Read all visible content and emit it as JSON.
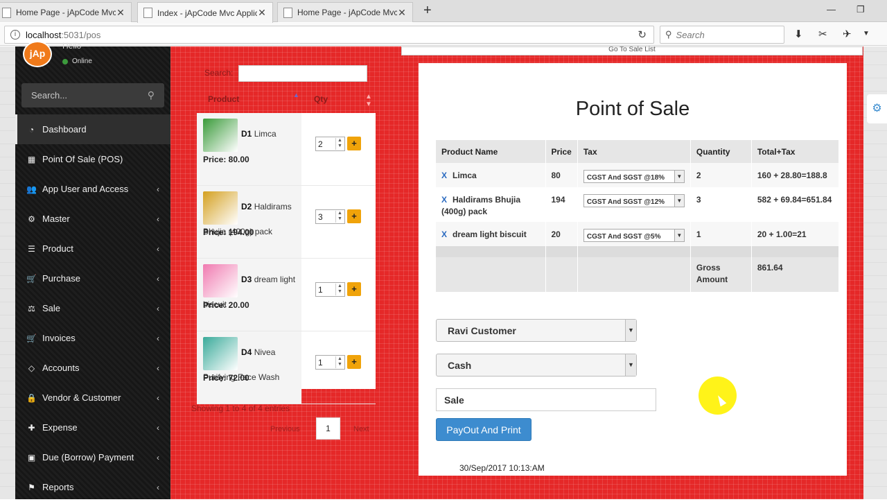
{
  "browser": {
    "tabs": [
      {
        "label": "Home Page - jApCode Mvc"
      },
      {
        "label": "Index - jApCode Mvc Applic"
      },
      {
        "label": "Home Page - jApCode Mvc"
      }
    ],
    "url_host": "localhost",
    "url_path": ":5031/pos",
    "search_placeholder": "Search"
  },
  "sidebar": {
    "avatar_text": "jAp",
    "greeting": "Hello",
    "status": "Online",
    "search_placeholder": "Search...",
    "items": [
      {
        "label": "Dashboard",
        "icon": "dashboard-icon",
        "glyph": "◔",
        "arrow": ""
      },
      {
        "label": "Point Of Sale (POS)",
        "icon": "calculator-icon",
        "glyph": "▦",
        "arrow": ""
      },
      {
        "label": "App User and Access",
        "icon": "users-icon",
        "glyph": "👥",
        "arrow": "‹"
      },
      {
        "label": "Master",
        "icon": "gear-icon",
        "glyph": "⚙",
        "arrow": "‹"
      },
      {
        "label": "Product",
        "icon": "list-icon",
        "glyph": "☰",
        "arrow": "‹"
      },
      {
        "label": "Purchase",
        "icon": "cart-icon",
        "glyph": "🛒",
        "arrow": "‹"
      },
      {
        "label": "Sale",
        "icon": "scale-icon",
        "glyph": "⚖",
        "arrow": "‹"
      },
      {
        "label": "Invoices",
        "icon": "cart-icon",
        "glyph": "🛒",
        "arrow": "‹"
      },
      {
        "label": "Accounts",
        "icon": "diamond-icon",
        "glyph": "◇",
        "arrow": "‹"
      },
      {
        "label": "Vendor & Customer",
        "icon": "lock-icon",
        "glyph": "🔒",
        "arrow": "‹"
      },
      {
        "label": "Expense",
        "icon": "plus-icon",
        "glyph": "✚",
        "arrow": "‹"
      },
      {
        "label": "Due (Borrow) Payment",
        "icon": "money-icon",
        "glyph": "▣",
        "arrow": "‹"
      },
      {
        "label": "Reports",
        "icon": "flag-icon",
        "glyph": "⚑",
        "arrow": "‹"
      }
    ]
  },
  "top": {
    "sale_list_link": "Go To Sale List"
  },
  "products": {
    "search_label": "Search:",
    "col_product": "Product",
    "col_qty": "Qty",
    "items": [
      {
        "code": "D1",
        "name": "Limca",
        "price": "Price: 80.00",
        "qty": "2",
        "color": "#3a9a3a"
      },
      {
        "code": "D2",
        "name": "Haldirams Bhujia (400g) pack",
        "price": "Price: 194.00",
        "qty": "3",
        "color": "#d4a020"
      },
      {
        "code": "D3",
        "name": "dream light biscuit",
        "price": "Price: 20.00",
        "qty": "1",
        "color": "#f07ab0"
      },
      {
        "code": "D4",
        "name": "Nivea Purifying Face Wash",
        "price": "Price: 72.00",
        "qty": "1",
        "color": "#3aaa9a"
      }
    ],
    "info": "Showing 1 to 4 of 4 entries",
    "prev": "Previous",
    "page": "1",
    "next": "Next"
  },
  "pos": {
    "title": "Point of Sale",
    "headers": [
      "Product Name",
      "Price",
      "Tax",
      "Quantity",
      "Total+Tax"
    ],
    "rows": [
      {
        "remove": "X",
        "name": "Limca",
        "price": "80",
        "tax": "CGST And SGST @18%",
        "qty": "2",
        "total": "160 + 28.80=188.8"
      },
      {
        "remove": "X",
        "name": "Haldirams Bhujia (400g) pack",
        "price": "194",
        "tax": "CGST And SGST @12%",
        "qty": "3",
        "total": "582 + 69.84=651.84"
      },
      {
        "remove": "X",
        "name": "dream light biscuit",
        "price": "20",
        "tax": "CGST And SGST @5%",
        "qty": "1",
        "total": "20 + 1.00=21"
      }
    ],
    "gross_label": "Gross Amount",
    "gross_value": "861.64",
    "customer": "Ravi Customer",
    "payment_mode": "Cash",
    "sale_type": "Sale",
    "pay_button": "PayOut And Print",
    "datetime": "30/Sep/2017 10:13:AM"
  }
}
